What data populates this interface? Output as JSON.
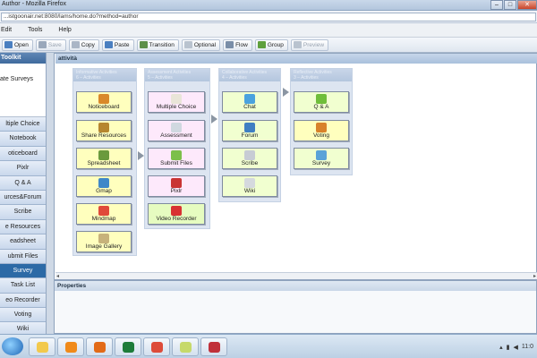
{
  "window": {
    "title": "Author - Mozilla Firefox",
    "controls": {
      "minimize": "–",
      "maximize": "□",
      "close": "✕"
    }
  },
  "address": {
    "url": "...istgoonair.net:8080/lams/home.do?method=author"
  },
  "menu": [
    "Edit",
    "Tools",
    "Help"
  ],
  "toolbar": [
    {
      "label": "Open",
      "icon": "open-icon",
      "color": "#4a7fc0",
      "enabled": true
    },
    {
      "label": "Save",
      "icon": "save-icon",
      "color": "#9aa8bb",
      "enabled": false
    },
    {
      "label": "Copy",
      "icon": "copy-icon",
      "color": "#aab6c6",
      "enabled": true
    },
    {
      "label": "Paste",
      "icon": "paste-icon",
      "color": "#4a7fc0",
      "enabled": true
    },
    {
      "label": "Transition",
      "icon": "transition-icon",
      "color": "#5d8f4a",
      "enabled": true
    },
    {
      "label": "Optional",
      "icon": "optional-icon",
      "color": "#b9c3cf",
      "enabled": true
    },
    {
      "label": "Flow",
      "icon": "flow-icon",
      "color": "#7a8ea8",
      "enabled": true
    },
    {
      "label": "Group",
      "icon": "group-icon",
      "color": "#5fa03c",
      "enabled": true
    },
    {
      "label": "Preview",
      "icon": "preview-icon",
      "color": "#b9c3cf",
      "enabled": false
    }
  ],
  "sidebar": {
    "header": "Toolkit",
    "panel_text": "ate Surveys",
    "active_index": 10,
    "items": [
      "ltiple Choice",
      "Notebook",
      "oticeboard",
      "Pixlr",
      "Q & A",
      "urces&Forum",
      "Scribe",
      "e Resources",
      "eadsheet",
      "ubmit Files",
      "Survey",
      "Task List",
      "eo Recorder",
      "Voting",
      "Wiki"
    ]
  },
  "canvas": {
    "tab_label": "attività",
    "groups": [
      {
        "title": "Informative Activities",
        "sub": "6 – Activities"
      },
      {
        "title": "Assessment Activities",
        "sub": "5 – Activities"
      },
      {
        "title": "Collaborative Activities",
        "sub": "4 – Activities"
      },
      {
        "title": "Reflective Activities",
        "sub": "3 – Activities"
      }
    ],
    "activities": [
      {
        "label": "Noticeboard",
        "color": "#d9892a"
      },
      {
        "label": "Share Resources",
        "color": "#b6862f"
      },
      {
        "label": "Spreadsheet",
        "color": "#6a9a3d"
      },
      {
        "label": "Gmap",
        "color": "#3f88c8"
      },
      {
        "label": "Mindmap",
        "color": "#e04a3a"
      },
      {
        "label": "Image Gallery",
        "color": "#c7b27a"
      },
      {
        "label": "Multiple Choice",
        "color": "#e9e5d8"
      },
      {
        "label": "Assessment",
        "color": "#d0d8e0"
      },
      {
        "label": "Submit Files",
        "color": "#7cbf4a"
      },
      {
        "label": "Pixlr",
        "color": "#c93434"
      },
      {
        "label": "Video Recorder",
        "color": "#d83232"
      },
      {
        "label": "Chat",
        "color": "#4aa2de"
      },
      {
        "label": "Forum",
        "color": "#3f7fc2"
      },
      {
        "label": "Scribe",
        "color": "#c7ccd4"
      },
      {
        "label": "Wiki",
        "color": "#d5d9de"
      },
      {
        "label": "Q & A",
        "color": "#6fbe3a"
      },
      {
        "label": "Voting",
        "color": "#d8822a"
      },
      {
        "label": "Survey",
        "color": "#5aa3d8"
      }
    ]
  },
  "properties": {
    "label": "Properties"
  },
  "taskbar": {
    "apps": [
      {
        "icon": "explorer-icon",
        "color": "#f2c94c"
      },
      {
        "icon": "media-player-icon",
        "color": "#f08a1a"
      },
      {
        "icon": "firefox-icon",
        "color": "#e26a17"
      },
      {
        "icon": "excel-icon",
        "color": "#1d7c3a"
      },
      {
        "icon": "chrome-icon",
        "color": "#dd4b39"
      },
      {
        "icon": "sticky-notes-icon",
        "color": "#c6d96a"
      },
      {
        "icon": "app-icon",
        "color": "#c0303a"
      }
    ],
    "clock": "11:0"
  }
}
